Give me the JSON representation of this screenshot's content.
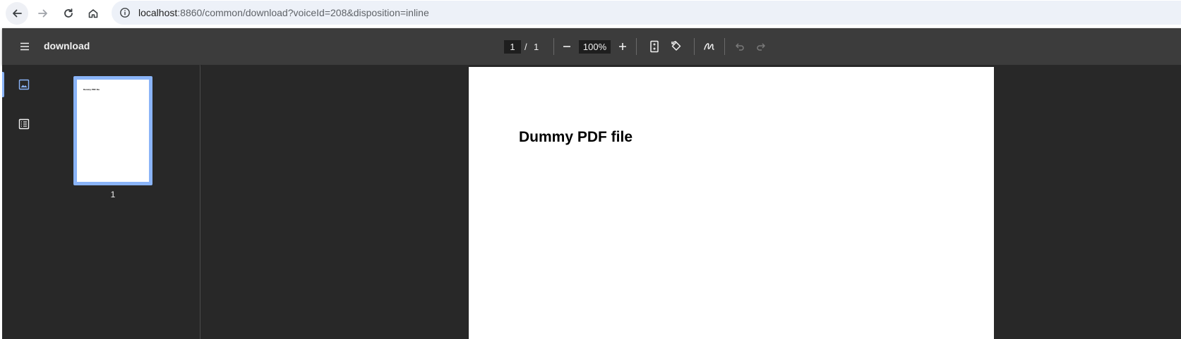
{
  "browser": {
    "url_host": "localhost",
    "url_path": ":8860/common/download?voiceId=208&disposition=inline"
  },
  "toolbar": {
    "title": "download",
    "current_page": "1",
    "page_separator": "/",
    "total_pages": "1",
    "zoom": "100%"
  },
  "sidebar": {
    "thumbnail_label": "1",
    "thumbnail_text": "Dummy PDF file"
  },
  "document": {
    "heading": "Dummy PDF file"
  },
  "colors": {
    "accent": "#8ab4f8",
    "toolbar_bg": "#3c3c3c",
    "viewer_bg": "#282828"
  }
}
